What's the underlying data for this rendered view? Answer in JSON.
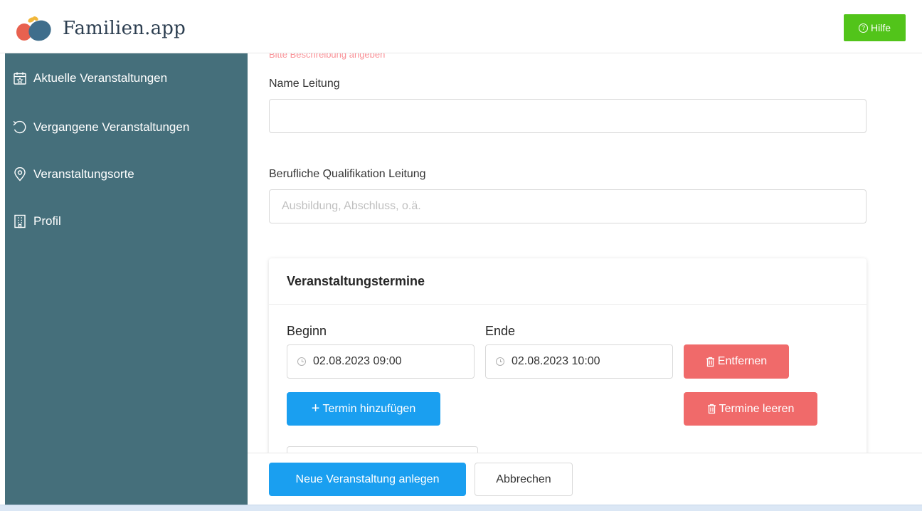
{
  "header": {
    "app_name": "Familien.app",
    "help_label": "Hilfe"
  },
  "sidebar": {
    "items": [
      {
        "label": "Aktuelle Veranstaltungen",
        "icon": "calendar-star-icon"
      },
      {
        "label": "Vergangene Veranstaltungen",
        "icon": "history-icon"
      },
      {
        "label": "Veranstaltungsorte",
        "icon": "location-pin-icon"
      },
      {
        "label": "Profil",
        "icon": "building-icon"
      }
    ]
  },
  "form": {
    "error_text": "Bitte Beschreibung angeben",
    "leader_name": {
      "label": "Name Leitung",
      "value": "",
      "placeholder": ""
    },
    "leader_qualification": {
      "label": "Berufliche Qualifikation Leitung",
      "value": "",
      "placeholder": "Ausbildung, Abschluss, o.ä."
    }
  },
  "dates_card": {
    "title": "Veranstaltungstermine",
    "begin_label": "Beginn",
    "end_label": "Ende",
    "entries": [
      {
        "begin": "02.08.2023 09:00",
        "end": "02.08.2023 10:00",
        "remove_label": "Entfernen"
      }
    ],
    "add_label": "Termin hinzufügen",
    "clear_label": "Termine leeren"
  },
  "footer": {
    "submit_label": "Neue Veranstaltung anlegen",
    "cancel_label": "Abbrechen"
  },
  "colors": {
    "sidebar_bg": "#456f7b",
    "primary": "#1a9ff0",
    "danger": "#f06a6a",
    "success": "#52c41a"
  }
}
